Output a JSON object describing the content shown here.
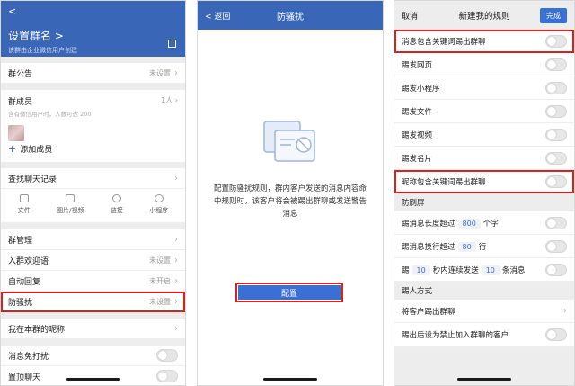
{
  "panel1": {
    "back": "<",
    "title": "设置群名 >",
    "subtitle": "该群由企业微信用户创建",
    "announcement": {
      "label": "群公告",
      "value": "未设置"
    },
    "members": {
      "label": "群成员",
      "hint": "含有微信用户时，人数可达 200",
      "value": "1人",
      "add": "添加成员"
    },
    "history": {
      "label": "查找聊天记录"
    },
    "history_icons": [
      "文件",
      "图片/视频",
      "链接",
      "小程序"
    ],
    "manage": {
      "label": "群管理"
    },
    "welcome": {
      "label": "入群欢迎语",
      "value": "未设置"
    },
    "autoreply": {
      "label": "自动回复",
      "value": "未开启"
    },
    "antispam": {
      "label": "防骚扰",
      "value": "未设置"
    },
    "nickname": {
      "label": "我在本群的昵称"
    },
    "mute": {
      "label": "消息免打扰"
    },
    "pin": {
      "label": "置顶聊天"
    }
  },
  "panel2": {
    "back": "< 返回",
    "title": "防骚扰",
    "description": "配置防骚扰规则，群内客户发送的消息内容命中规则时，该客户将会被踢出群聊或发送警告消息",
    "button": "配置"
  },
  "panel3": {
    "cancel": "取消",
    "title": "新建我的规则",
    "done": "完成",
    "rules": [
      "消息包含关键词踢出群聊",
      "踢发网页",
      "踢发小程序",
      "踢发文件",
      "踢发视频",
      "踢发名片",
      "昵称包含关键词踢出群聊"
    ],
    "flood_section": "防刷屏",
    "flood1": {
      "pre": "踢消息长度超过",
      "num": "800",
      "post": "个字"
    },
    "flood2": {
      "pre": "踢消息换行超过",
      "num": "80",
      "post": "行"
    },
    "flood3": {
      "pre": "踢",
      "num1": "10",
      "mid": "秒内连续发送",
      "num2": "10",
      "post": "条消息"
    },
    "kick_section": "踢人方式",
    "kick1": "将客户踢出群聊",
    "kick2": "踢出后设为禁止加入群聊的客户"
  },
  "colors": {
    "accent": "#3a66b8",
    "button": "#3a6fd6",
    "highlight": "#d9211d"
  }
}
